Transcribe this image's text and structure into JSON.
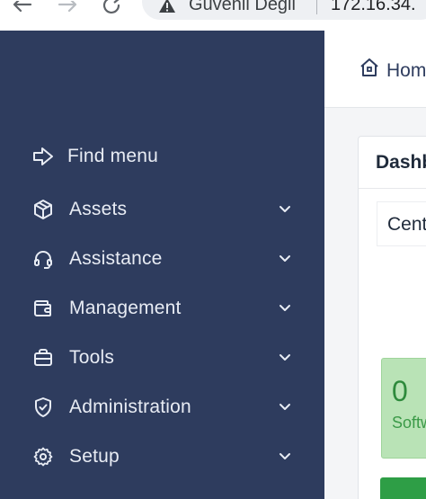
{
  "browser": {
    "security_text": "Güvenli Değil",
    "url": "172.16.34."
  },
  "sidebar": {
    "items": [
      {
        "label": "Find menu",
        "icon": "arrow-right-icon",
        "has_chevron": false
      },
      {
        "label": "Assets",
        "icon": "cube-icon",
        "has_chevron": true
      },
      {
        "label": "Assistance",
        "icon": "headset-icon",
        "has_chevron": true
      },
      {
        "label": "Management",
        "icon": "wallet-icon",
        "has_chevron": true
      },
      {
        "label": "Tools",
        "icon": "briefcase-icon",
        "has_chevron": true
      },
      {
        "label": "Administration",
        "icon": "shield-check-icon",
        "has_chevron": true
      },
      {
        "label": "Setup",
        "icon": "gear-icon",
        "has_chevron": true
      }
    ]
  },
  "main": {
    "breadcrumb_home": "Hom",
    "card_title": "Dashb",
    "tab_label": "Cent",
    "stat": {
      "value": "0",
      "label": "Softw"
    }
  },
  "colors": {
    "sidebar_bg": "#2e3c5e",
    "stat_bg": "#b9e3b6",
    "stat_text": "#2e8a3c",
    "button_green": "#2e9e46"
  }
}
